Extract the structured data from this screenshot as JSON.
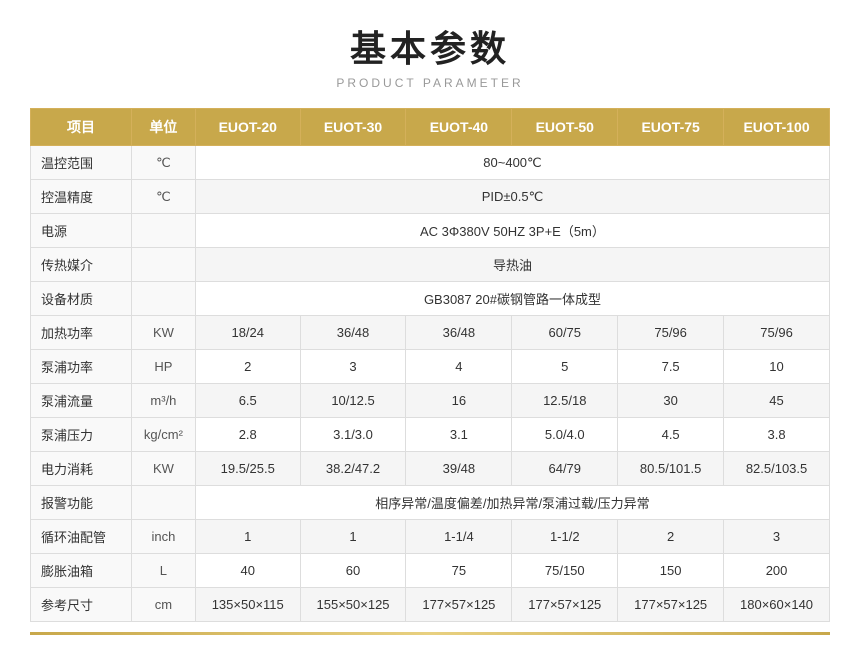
{
  "title": "基本参数",
  "subtitle": "PRODUCT PARAMETER",
  "table": {
    "headers": [
      "项目",
      "单位",
      "EUOT-20",
      "EUOT-30",
      "EUOT-40",
      "EUOT-50",
      "EUOT-75",
      "EUOT-100"
    ],
    "rows": [
      {
        "label": "温控范围",
        "unit": "℃",
        "span": true,
        "spanValue": "80~400℃"
      },
      {
        "label": "控温精度",
        "unit": "℃",
        "span": true,
        "spanValue": "PID±0.5℃"
      },
      {
        "label": "电源",
        "unit": "",
        "span": true,
        "spanValue": "AC 3Φ380V 50HZ 3P+E（5m）"
      },
      {
        "label": "传热媒介",
        "unit": "",
        "span": true,
        "spanValue": "导热油"
      },
      {
        "label": "设备材质",
        "unit": "",
        "span": true,
        "spanValue": "GB3087   20#碳钢管路一体成型"
      },
      {
        "label": "加热功率",
        "unit": "KW",
        "span": false,
        "values": [
          "18/24",
          "36/48",
          "36/48",
          "60/75",
          "75/96",
          "75/96"
        ]
      },
      {
        "label": "泵浦功率",
        "unit": "HP",
        "span": false,
        "values": [
          "2",
          "3",
          "4",
          "5",
          "7.5",
          "10"
        ]
      },
      {
        "label": "泵浦流量",
        "unit": "m³/h",
        "span": false,
        "values": [
          "6.5",
          "10/12.5",
          "16",
          "12.5/18",
          "30",
          "45"
        ]
      },
      {
        "label": "泵浦压力",
        "unit": "kg/cm²",
        "span": false,
        "values": [
          "2.8",
          "3.1/3.0",
          "3.1",
          "5.0/4.0",
          "4.5",
          "3.8"
        ]
      },
      {
        "label": "电力消耗",
        "unit": "KW",
        "span": false,
        "values": [
          "19.5/25.5",
          "38.2/47.2",
          "39/48",
          "64/79",
          "80.5/101.5",
          "82.5/103.5"
        ]
      },
      {
        "label": "报警功能",
        "unit": "",
        "span": true,
        "spanValue": "相序异常/温度偏差/加热异常/泵浦过载/压力异常"
      },
      {
        "label": "循环油配管",
        "unit": "inch",
        "span": false,
        "values": [
          "1",
          "1",
          "1-1/4",
          "1-1/2",
          "2",
          "3"
        ]
      },
      {
        "label": "膨胀油箱",
        "unit": "L",
        "span": false,
        "values": [
          "40",
          "60",
          "75",
          "75/150",
          "150",
          "200"
        ]
      },
      {
        "label": "参考尺寸",
        "unit": "cm",
        "span": false,
        "values": [
          "135×50×115",
          "155×50×125",
          "177×57×125",
          "177×57×125",
          "177×57×125",
          "180×60×140"
        ]
      }
    ]
  }
}
